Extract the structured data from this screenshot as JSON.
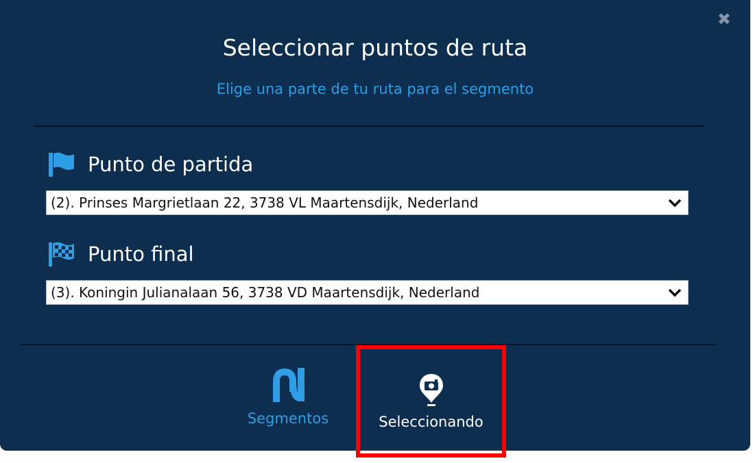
{
  "modal": {
    "title": "Seleccionar puntos de ruta",
    "subtitle": "Elige una parte de tu ruta para el segmento",
    "close_icon": "close-icon"
  },
  "start": {
    "label": "Punto de partida",
    "icon": "flag-icon",
    "selected": "(2). Prinses Margrietlaan 22, 3738 VL Maartensdijk, Nederland"
  },
  "end": {
    "label": "Punto final",
    "icon": "checkered-flag-icon",
    "selected": "(3). Koningin Julianalaan 56, 3738 VD Maartensdijk, Nederland"
  },
  "tabs": [
    {
      "label": "Segmentos",
      "icon": "segments-icon",
      "active": false
    },
    {
      "label": "Seleccionando",
      "icon": "camera-pin-icon",
      "active": true
    }
  ],
  "colors": {
    "background": "#0d2e4e",
    "accent": "#2e9fe6",
    "highlight": "#ff0000"
  }
}
